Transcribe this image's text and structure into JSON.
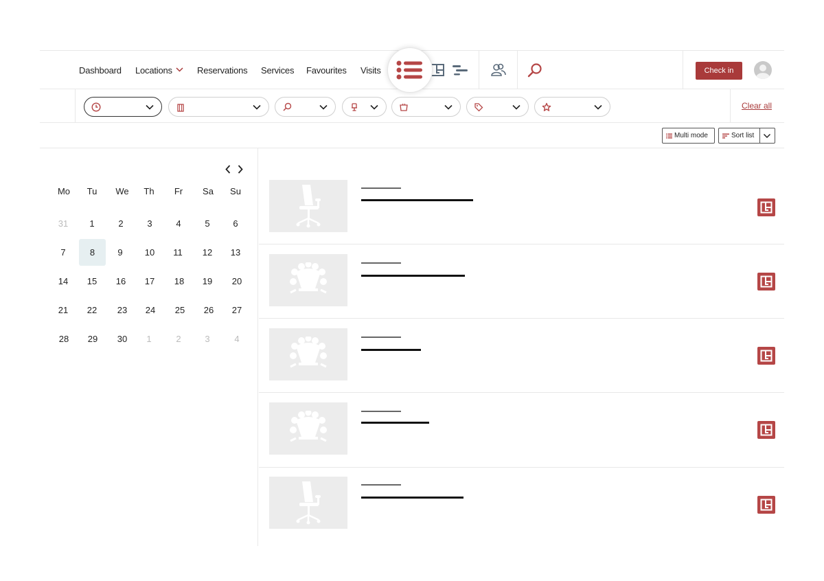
{
  "nav": {
    "items": [
      {
        "label": "Dashboard"
      },
      {
        "label": "Locations"
      },
      {
        "label": "Reservations"
      },
      {
        "label": "Services"
      },
      {
        "label": "Favourites"
      },
      {
        "label": "Visits"
      }
    ],
    "check_in_label": "Check in"
  },
  "filters": {
    "clear_all_label": "Clear all"
  },
  "toolbar": {
    "multi_mode_label": "Multi mode",
    "sort_list_label": "Sort list"
  },
  "calendar": {
    "weekdays": [
      "Mo",
      "Tu",
      "We",
      "Th",
      "Fr",
      "Sa",
      "Su"
    ],
    "weeks": [
      [
        "31",
        "1",
        "2",
        "3",
        "4",
        "5",
        "6"
      ],
      [
        "7",
        "8",
        "9",
        "10",
        "11",
        "12",
        "13"
      ],
      [
        "14",
        "15",
        "16",
        "17",
        "18",
        "19",
        "20"
      ],
      [
        "21",
        "22",
        "23",
        "24",
        "25",
        "26",
        "27"
      ],
      [
        "28",
        "29",
        "30",
        "1",
        "2",
        "3",
        "4"
      ]
    ],
    "selected_day": "8"
  },
  "results": [
    {
      "kind": "chair-icon"
    },
    {
      "kind": "meeting-room-icon"
    },
    {
      "kind": "meeting-room-icon"
    },
    {
      "kind": "meeting-room-icon"
    },
    {
      "kind": "chair-icon"
    }
  ],
  "colors": {
    "accent": "#a93a3a",
    "selected_day_bg": "#e6eff1"
  }
}
